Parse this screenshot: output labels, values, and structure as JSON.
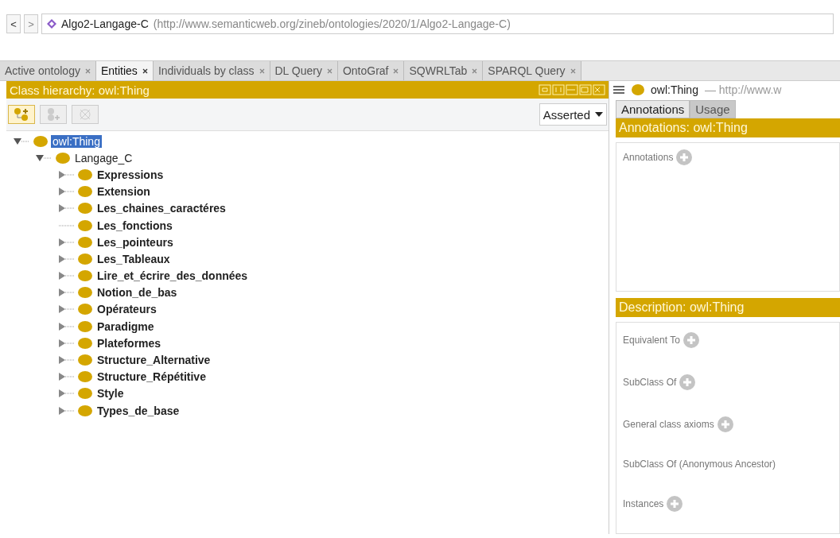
{
  "nav": {
    "back": "<",
    "forward": ">",
    "ontology_name": "Algo2-Langage-C",
    "ontology_iri": "(http://www.semanticweb.org/zineb/ontologies/2020/1/Algo2-Langage-C)"
  },
  "tabs": [
    {
      "label": "Active ontology",
      "selected": false
    },
    {
      "label": "Entities",
      "selected": true
    },
    {
      "label": "Individuals by class",
      "selected": false
    },
    {
      "label": "DL Query",
      "selected": false
    },
    {
      "label": "OntoGraf",
      "selected": false
    },
    {
      "label": "SQWRLTab",
      "selected": false
    },
    {
      "label": "SPARQL Query",
      "selected": false
    }
  ],
  "class_hierarchy": {
    "title": "Class hierarchy: owl:Thing",
    "mode": "Asserted",
    "tree": [
      {
        "label": "owl:Thing",
        "selected": true,
        "bold": false,
        "expanded": true,
        "children": [
          {
            "label": "Langage_C",
            "selected": false,
            "bold": false,
            "expanded": true,
            "children": [
              {
                "label": "Expressions",
                "selected": false,
                "bold": true,
                "expanded": false,
                "expandable": true
              },
              {
                "label": "Extension",
                "selected": false,
                "bold": true,
                "expanded": false,
                "expandable": true
              },
              {
                "label": "Les_chaines_caractéres",
                "selected": false,
                "bold": true,
                "expanded": false,
                "expandable": true
              },
              {
                "label": "Les_fonctions",
                "selected": false,
                "bold": true,
                "expanded": false,
                "expandable": false
              },
              {
                "label": "Les_pointeurs",
                "selected": false,
                "bold": true,
                "expanded": false,
                "expandable": true
              },
              {
                "label": "Les_Tableaux",
                "selected": false,
                "bold": true,
                "expanded": false,
                "expandable": true
              },
              {
                "label": "Lire_et_écrire_des_données",
                "selected": false,
                "bold": true,
                "expanded": false,
                "expandable": true
              },
              {
                "label": "Notion_de_bas",
                "selected": false,
                "bold": true,
                "expanded": false,
                "expandable": true
              },
              {
                "label": "Opérateurs",
                "selected": false,
                "bold": true,
                "expanded": false,
                "expandable": true
              },
              {
                "label": "Paradigme",
                "selected": false,
                "bold": true,
                "expanded": false,
                "expandable": true
              },
              {
                "label": "Plateformes",
                "selected": false,
                "bold": true,
                "expanded": false,
                "expandable": true
              },
              {
                "label": "Structure_Alternative",
                "selected": false,
                "bold": true,
                "expanded": false,
                "expandable": true
              },
              {
                "label": "Structure_Répétitive",
                "selected": false,
                "bold": true,
                "expanded": false,
                "expandable": true
              },
              {
                "label": "Style",
                "selected": false,
                "bold": true,
                "expanded": false,
                "expandable": true
              },
              {
                "label": "Types_de_base",
                "selected": false,
                "bold": true,
                "expanded": false,
                "expandable": true
              }
            ]
          }
        ]
      }
    ]
  },
  "entity": {
    "name": "owl:Thing",
    "iri": "— http://www.w",
    "tabs": [
      {
        "label": "Annotations",
        "selected": true
      },
      {
        "label": "Usage",
        "selected": false
      }
    ],
    "annotations": {
      "title": "Annotations: owl:Thing",
      "items": [
        "Annotations"
      ]
    },
    "description": {
      "title": "Description: owl:Thing",
      "items": [
        {
          "label": "Equivalent To",
          "addable": true
        },
        {
          "label": "SubClass Of",
          "addable": true
        },
        {
          "label": "General class axioms",
          "addable": true
        },
        {
          "label": "SubClass Of (Anonymous Ancestor)",
          "addable": false
        },
        {
          "label": "Instances",
          "addable": true
        }
      ]
    }
  }
}
